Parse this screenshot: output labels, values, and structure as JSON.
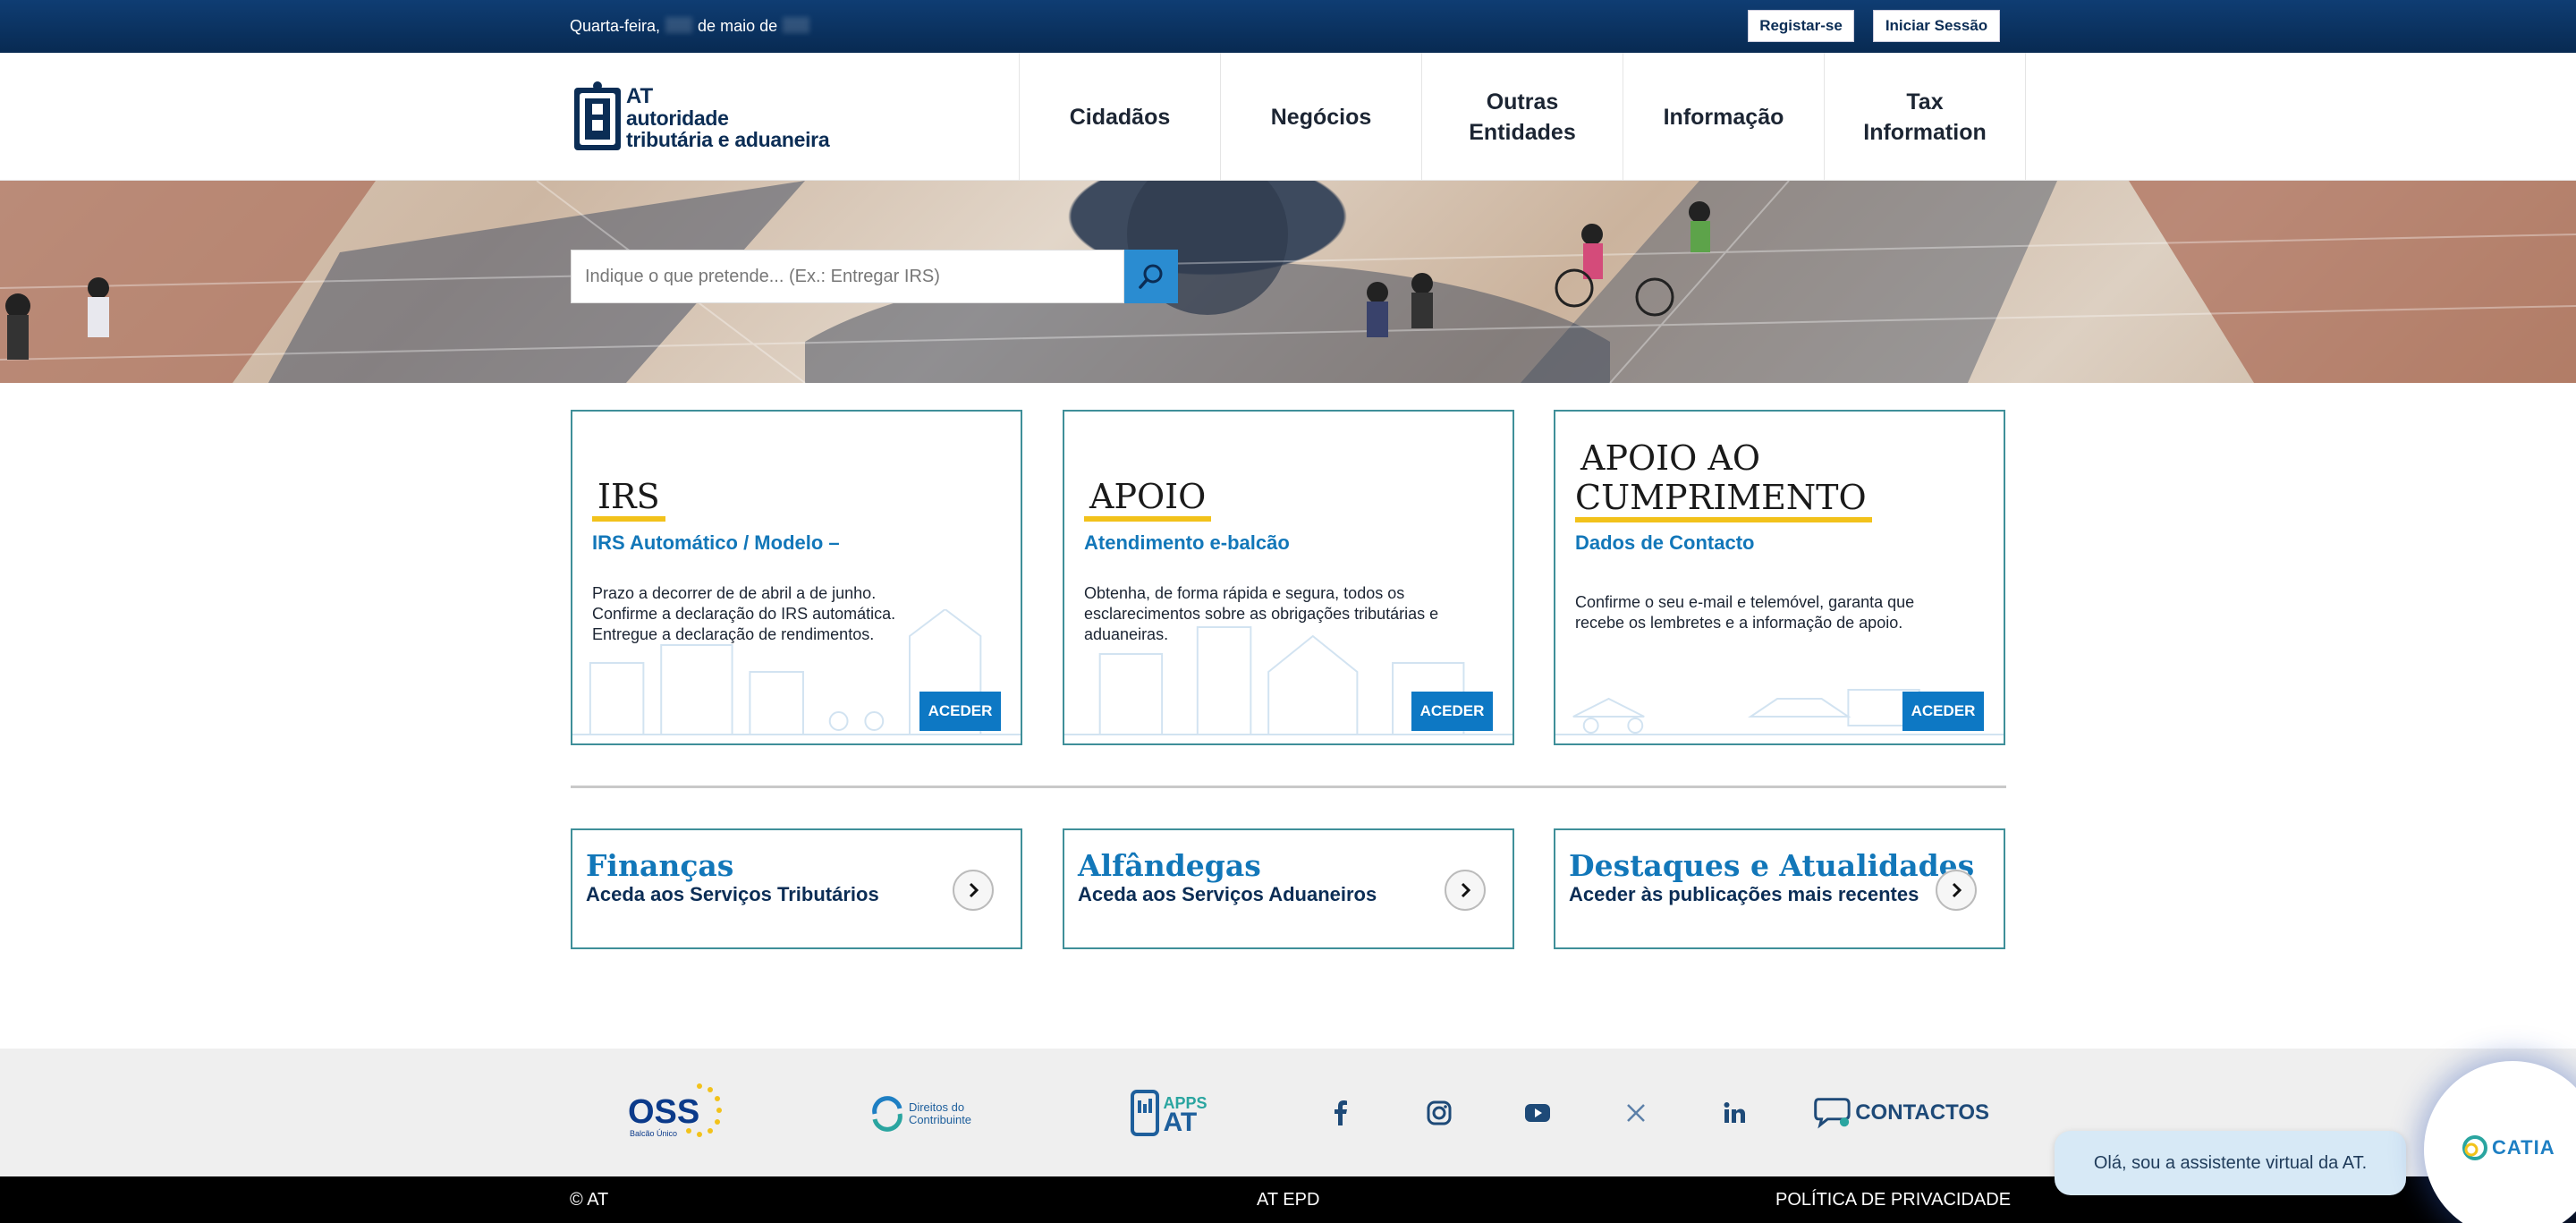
{
  "topbar": {
    "date_weekday": "Quarta-feira,",
    "date_month": "de maio de",
    "register_label": "Registar-se",
    "login_label": "Iniciar Sessão"
  },
  "logo": {
    "line1": "AT",
    "line2": "autoridade",
    "line3": "tributária e aduaneira"
  },
  "nav": {
    "items": [
      {
        "label": "Cidadãos"
      },
      {
        "label": "Negócios"
      },
      {
        "label": "Outras\nEntidades"
      },
      {
        "label": "Informação"
      },
      {
        "label": "Tax\nInformation"
      }
    ]
  },
  "search": {
    "placeholder": "Indique o que pretende... (Ex.: Entregar IRS)"
  },
  "cards": [
    {
      "title": "IRS",
      "subtitle": "IRS Automático / Modelo  –",
      "desc": "Prazo a decorrer de    de abril a     de junho.\nConfirme a declaração do IRS automática.\nEntregue a declaração de rendimentos.",
      "button": "ACEDER"
    },
    {
      "title": "APOIO",
      "subtitle": "Atendimento e-balcão",
      "desc": "Obtenha, de forma rápida e segura, todos os esclarecimentos sobre as obrigações tributárias e aduaneiras.",
      "button": "ACEDER"
    },
    {
      "title_line1": "APOIO AO",
      "title_line2": "CUMPRIMENTO",
      "subtitle": "Dados de Contacto",
      "desc": "Confirme o seu e-mail e telemóvel, garanta que recebe os lembretes e a informação de apoio.",
      "button": "ACEDER"
    }
  ],
  "links": [
    {
      "title": "Finanças",
      "subtitle": "Aceda aos Serviços Tributários"
    },
    {
      "title": "Alfândegas",
      "subtitle": "Aceda aos Serviços Aduaneiros"
    },
    {
      "title": "Destaques e Atualidades",
      "subtitle": "Aceder às publicações mais recentes"
    }
  ],
  "footer": {
    "oss_label": "OSS",
    "oss_sub": "Balcão Único",
    "direitos_line1": "Direitos do",
    "direitos_line2": "Contribuinte",
    "apps_line1": "APPS",
    "apps_line2": "AT",
    "contactos_label": "CONTACTOS",
    "social": [
      "facebook-icon",
      "instagram-icon",
      "youtube-icon",
      "x-icon",
      "linkedin-icon"
    ]
  },
  "bottom": {
    "copyright": "© AT",
    "epd": "AT EPD",
    "privacy": "POLÍTICA DE PRIVACIDADE"
  },
  "chat": {
    "message": "Olá, sou a assistente virtual da AT.",
    "brand": "CATIA"
  },
  "colors": {
    "topbar": "#0b3567",
    "card_border": "#3f8f99",
    "accent_blue": "#1277b9",
    "button_blue": "#0d78c4",
    "underline_yellow": "#f2c21b"
  }
}
